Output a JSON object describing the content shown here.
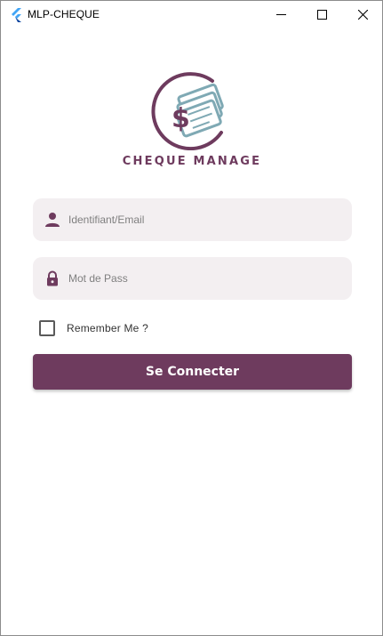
{
  "window": {
    "title": "MLP-CHEQUE",
    "icon": "flutter-logo-icon",
    "controls": [
      "minimize-icon",
      "maximize-icon",
      "close-icon"
    ]
  },
  "logo": {
    "text": "CHEQUE MANAGE",
    "icon": "cheque-money-icon"
  },
  "form": {
    "email": {
      "placeholder": "Identifiant/Email",
      "value": "",
      "icon": "person-icon"
    },
    "password": {
      "placeholder": "Mot de Pass",
      "value": "",
      "icon": "lock-icon"
    },
    "remember": {
      "label": "Remember Me ?",
      "checked": false
    },
    "submit_label": "Se Connecter"
  },
  "colors": {
    "primary": "#6e3b5e",
    "field_bg": "#f3eff1",
    "logo_secondary": "#7fa9b4"
  }
}
